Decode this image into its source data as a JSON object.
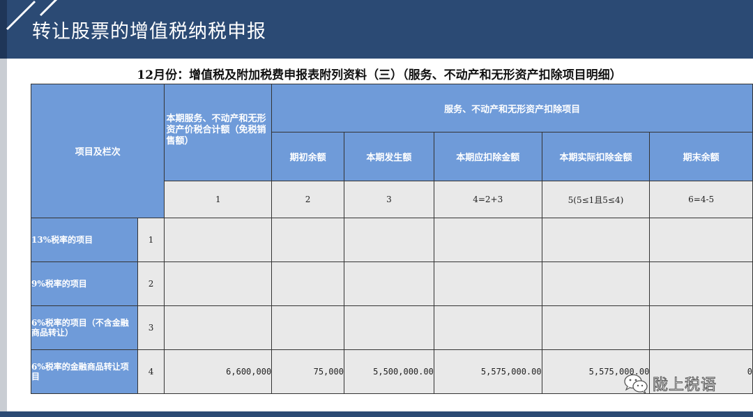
{
  "slide": {
    "title": "转让股票的增值税纳税申报"
  },
  "report": {
    "title": "12月份：增值税及附加税费申报表附列资料（三）（服务、不动产和无形资产扣除项目明细）",
    "header": {
      "project_col": "项目及栏次",
      "total_col": "本期服务、不动产和无形资产价税合计额（免税销售额）",
      "deduction_group": "服务、不动产和无形资产扣除项目",
      "sub_cols": [
        "期初余额",
        "本期发生额",
        "本期应扣除金额",
        "本期实际扣除金额",
        "期末余额"
      ],
      "col_numbers": [
        "1",
        "2",
        "3",
        "4=2+3",
        "5(5≤1且5≤4)",
        "6=4-5"
      ]
    },
    "rows": [
      {
        "label": "13%税率的项目",
        "idx": "1",
        "values": [
          "",
          "",
          "",
          "",
          "",
          ""
        ]
      },
      {
        "label": "9%税率的项目",
        "idx": "2",
        "values": [
          "",
          "",
          "",
          "",
          "",
          ""
        ]
      },
      {
        "label": "6%税率的项目（不含金融商品转让）",
        "idx": "3",
        "values": [
          "",
          "",
          "",
          "",
          "",
          ""
        ]
      },
      {
        "label": "6%税率的金融商品转让项目",
        "idx": "4",
        "values": [
          "6,600,000",
          "75,000",
          "5,500,000.00",
          "5,575,000.00",
          "5,575,000.00",
          "0"
        ]
      }
    ]
  },
  "watermark": {
    "text": "陇上税语",
    "icon": "wechat-icon"
  },
  "colors": {
    "header_bg": "#2b4a74",
    "table_header": "#6f9bd9",
    "cell_bg": "#e9e9e9"
  }
}
